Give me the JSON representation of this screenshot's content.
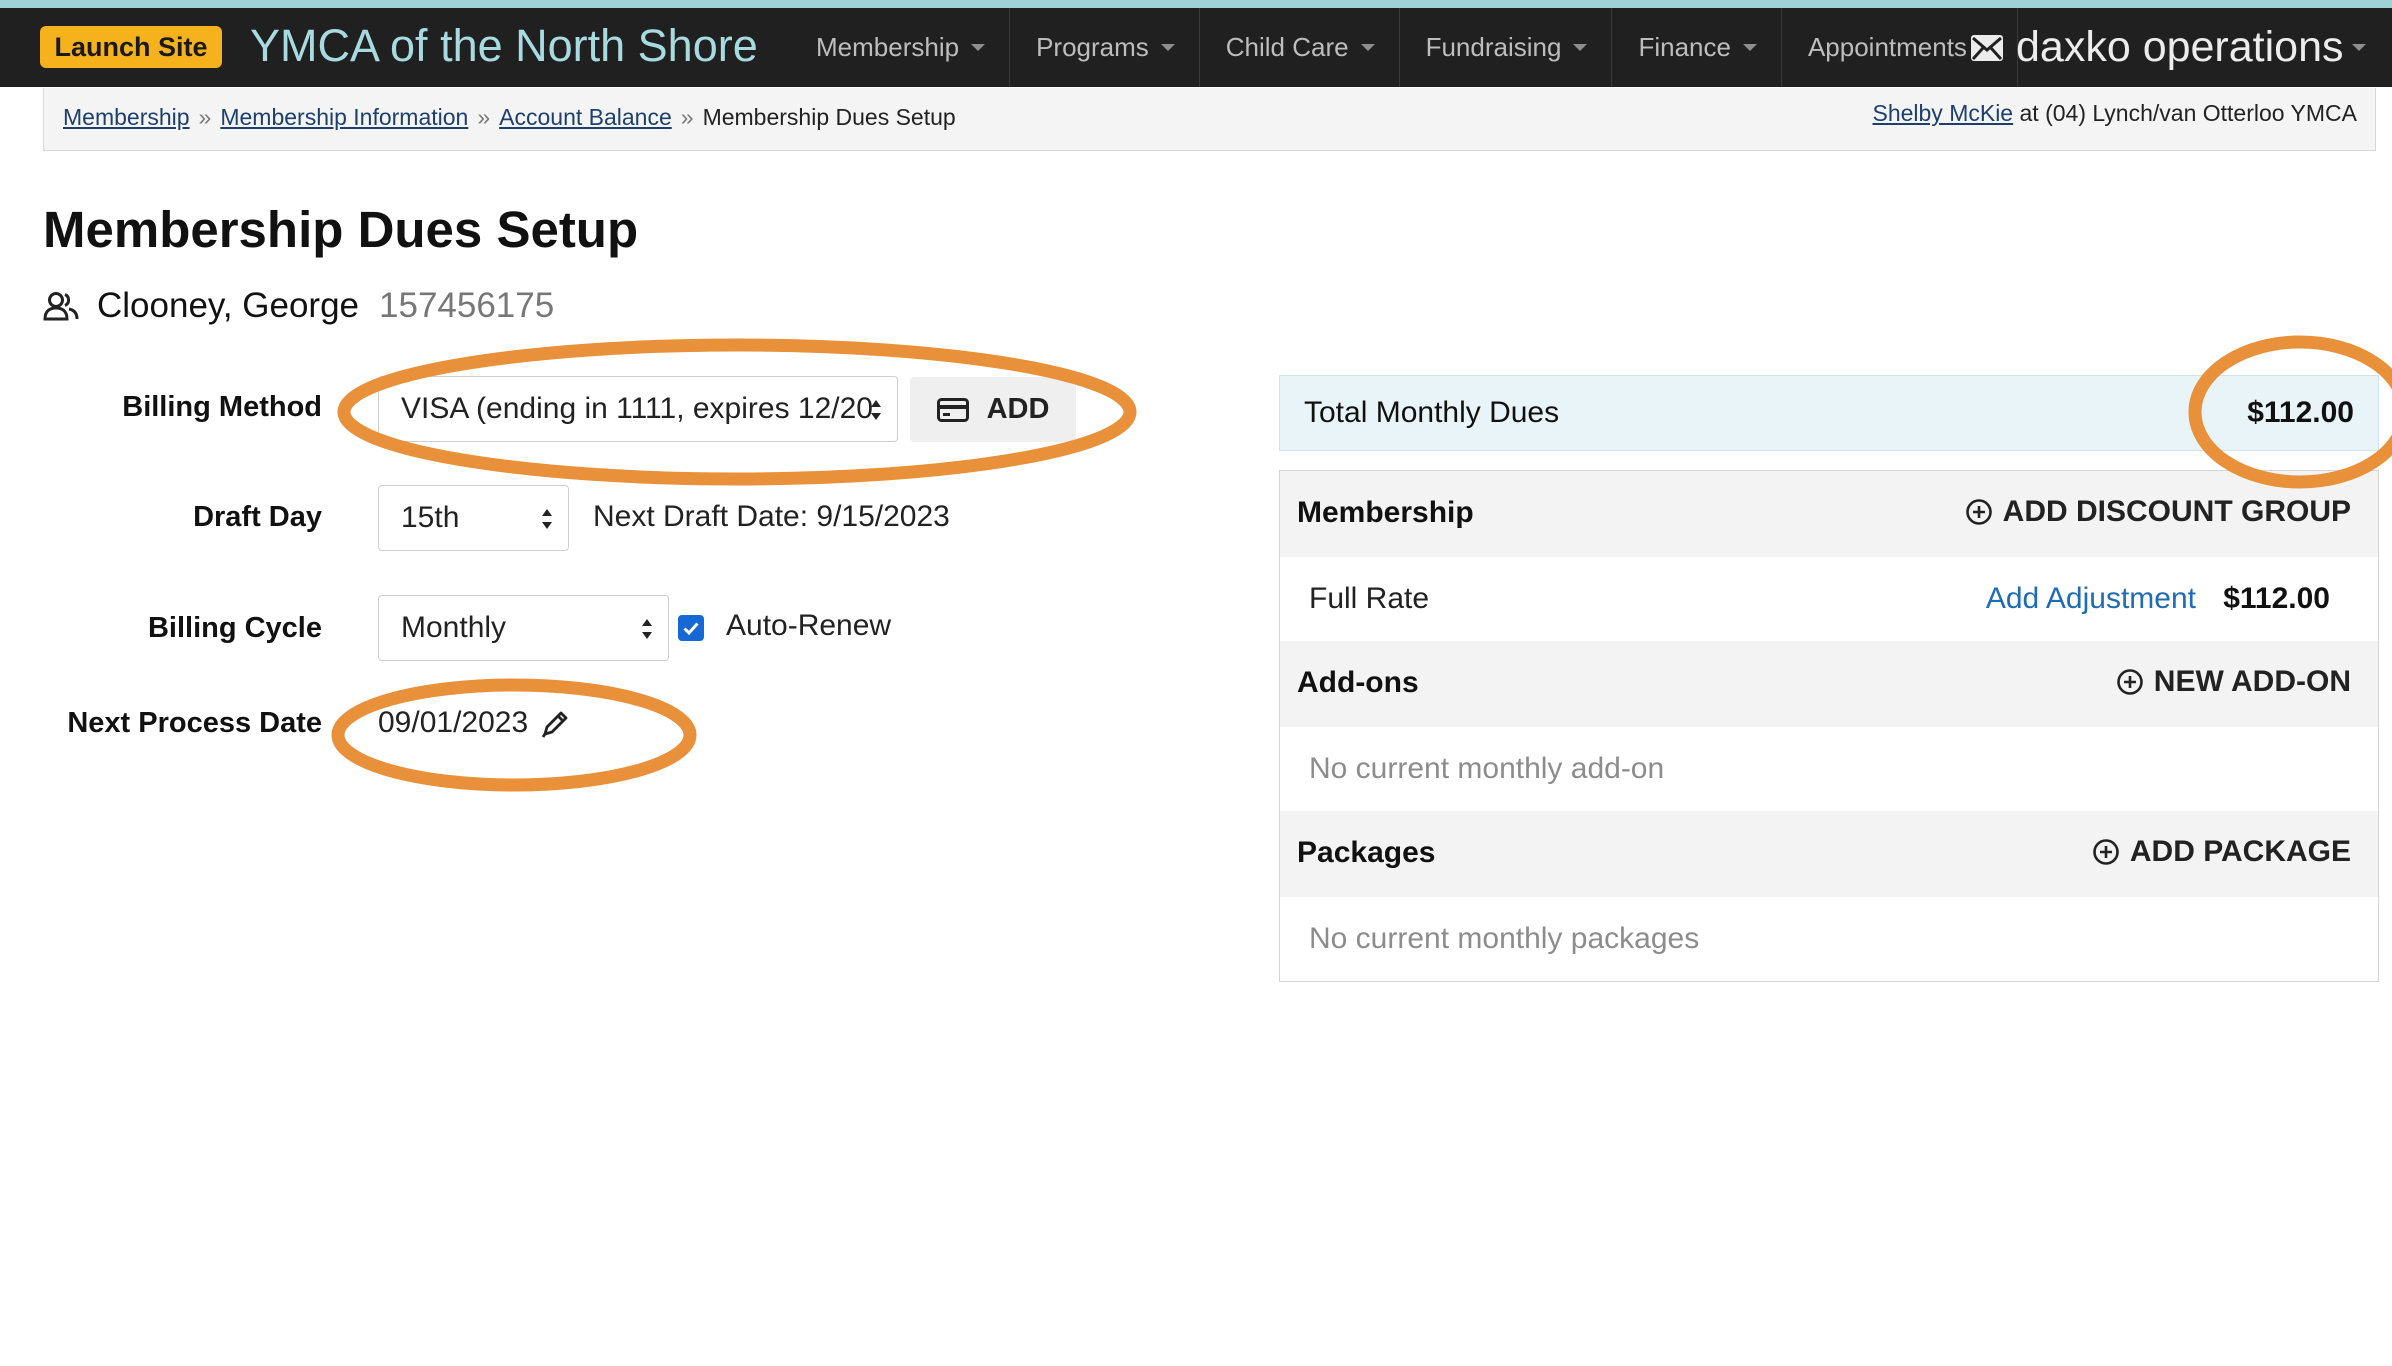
{
  "topnav": {
    "launch_site": "Launch Site",
    "org_name": "YMCA of the North Shore",
    "menu": [
      "Membership",
      "Programs",
      "Child Care",
      "Fundraising",
      "Finance",
      "Appointments"
    ],
    "brand": "daxko operations"
  },
  "breadcrumb": {
    "items": [
      "Membership",
      "Membership Information",
      "Account Balance"
    ],
    "current": "Membership Dues Setup"
  },
  "user": {
    "name": "Shelby McKie",
    "location": "at (04) Lynch/van Otterloo YMCA"
  },
  "page": {
    "title": "Membership Dues Setup",
    "member_name": "Clooney, George",
    "member_id": "157456175"
  },
  "form": {
    "billing_method_label": "Billing Method",
    "billing_method_value": "VISA (ending in 1111, expires 12/20",
    "add_label": "ADD",
    "draft_day_label": "Draft Day",
    "draft_day_value": "15th",
    "next_draft_date": "Next Draft Date: 9/15/2023",
    "billing_cycle_label": "Billing Cycle",
    "billing_cycle_value": "Monthly",
    "auto_renew_label": "Auto-Renew",
    "auto_renew_checked": true,
    "next_process_label": "Next Process Date",
    "next_process_value": "09/01/2023"
  },
  "summary": {
    "total_label": "Total Monthly Dues",
    "total_value": "$112.00",
    "membership": {
      "title": "Membership",
      "action": "ADD DISCOUNT GROUP",
      "rate_label": "Full Rate",
      "adjustment_link": "Add Adjustment",
      "rate_value": "$112.00"
    },
    "addons": {
      "title": "Add-ons",
      "action": "NEW ADD-ON",
      "empty": "No current monthly add-on"
    },
    "packages": {
      "title": "Packages",
      "action": "ADD PACKAGE",
      "empty": "No current monthly packages"
    }
  },
  "colors": {
    "nav_bg": "#202020",
    "launch_btn": "#f5b21d",
    "org_name": "#a8dbe0",
    "annotation": "#e8913a",
    "link": "#1e6bb8",
    "checkbox": "#1668d6"
  }
}
